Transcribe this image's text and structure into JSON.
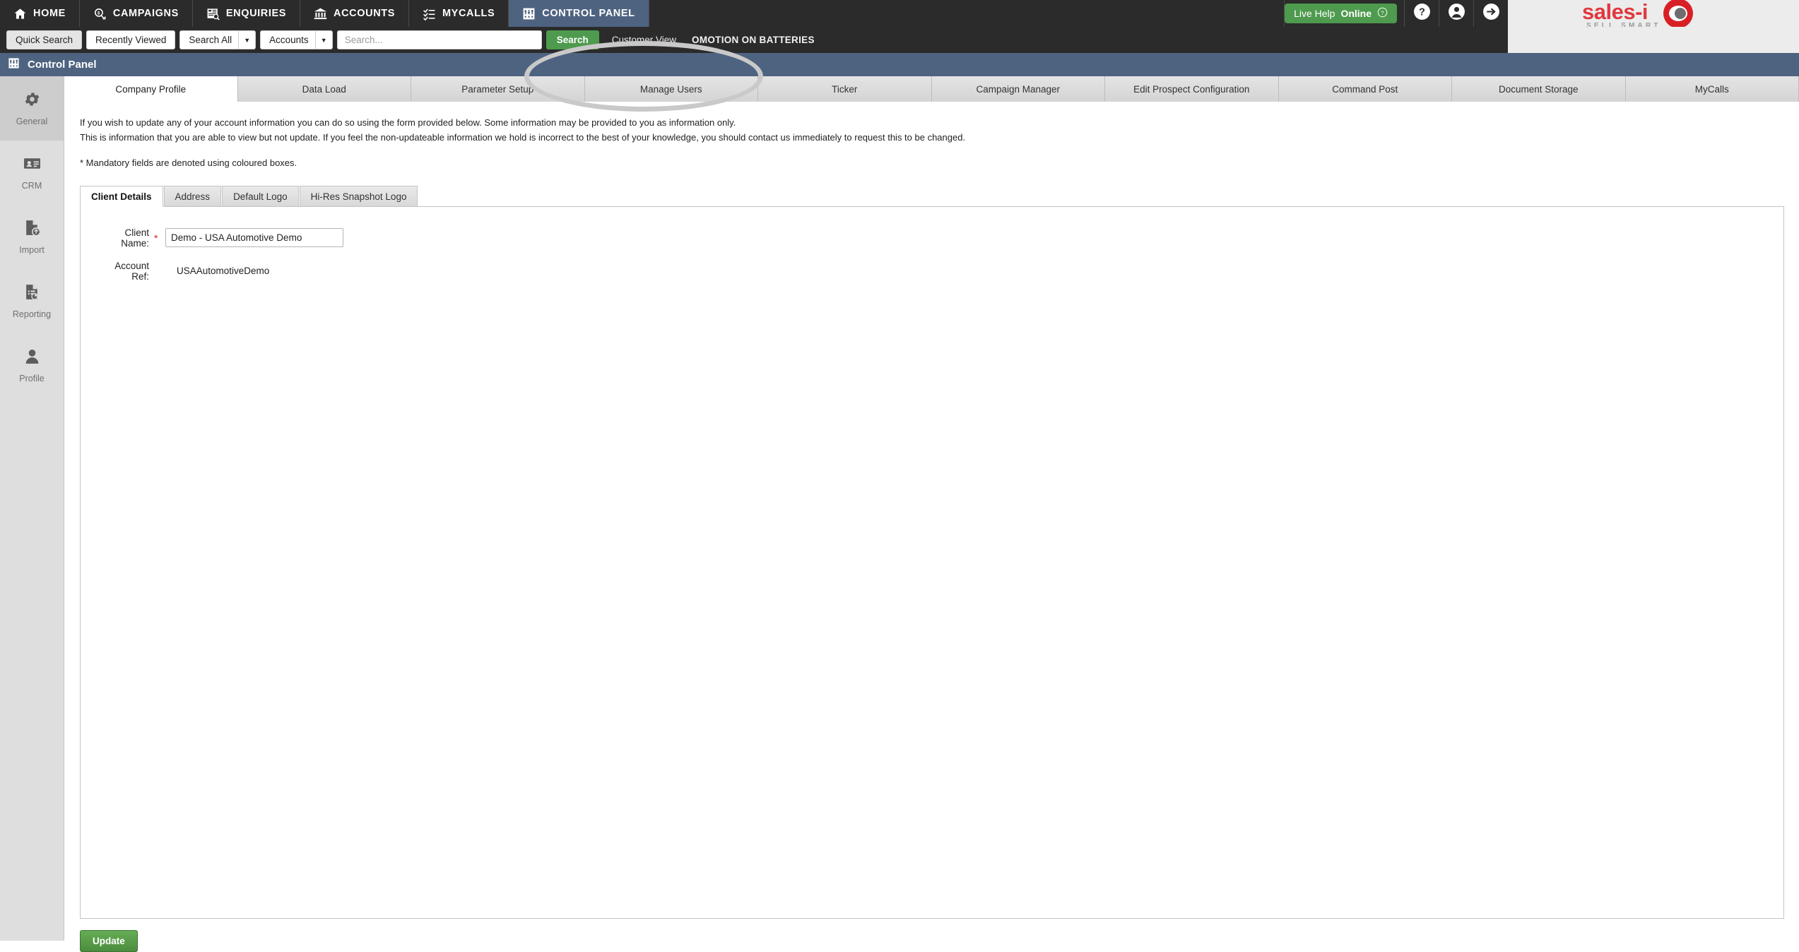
{
  "topnav": {
    "items": [
      {
        "label": "HOME",
        "icon": "home-icon",
        "active": false
      },
      {
        "label": "CAMPAIGNS",
        "icon": "campaigns-icon",
        "active": false
      },
      {
        "label": "ENQUIRIES",
        "icon": "enquiries-icon",
        "active": false
      },
      {
        "label": "ACCOUNTS",
        "icon": "accounts-icon",
        "active": false
      },
      {
        "label": "MYCALLS",
        "icon": "mycalls-icon",
        "active": false
      },
      {
        "label": "CONTROL PANEL",
        "icon": "control-panel-icon",
        "active": true
      }
    ],
    "live_help_light": "Live Help",
    "live_help_bold": "Online",
    "help_icon": "question-mark-icon",
    "account_icon": "user-avatar-icon",
    "logout_icon": "arrow-right-logout-icon"
  },
  "brand": {
    "name": "sales-i",
    "tagline": "SELL SMART",
    "logo_red": "#d81f26",
    "text_red": "#e0393f"
  },
  "searchbar": {
    "quick_search": "Quick Search",
    "recently_viewed": "Recently Viewed",
    "scope_select": "Search All",
    "type_select": "Accounts",
    "search_placeholder": "Search...",
    "search_value": "",
    "search_button": "Search",
    "customer_view": "Customer View",
    "ticker_text": "OMOTION ON BATTERIES"
  },
  "page_header": {
    "title": "Control Panel",
    "icon": "control-panel-icon",
    "bg": "#4e6380"
  },
  "sidebar": {
    "items": [
      {
        "label": "General",
        "icon": "gear-icon",
        "active": true
      },
      {
        "label": "CRM",
        "icon": "contact-card-icon",
        "active": false
      },
      {
        "label": "Import",
        "icon": "document-upload-icon",
        "active": false
      },
      {
        "label": "Reporting",
        "icon": "document-chart-icon",
        "active": false
      },
      {
        "label": "Profile",
        "icon": "person-icon",
        "active": false
      }
    ]
  },
  "tabs": [
    {
      "label": "Company Profile",
      "active": true
    },
    {
      "label": "Data Load",
      "active": false
    },
    {
      "label": "Parameter Setup",
      "active": false
    },
    {
      "label": "Manage Users",
      "active": false
    },
    {
      "label": "Ticker",
      "active": false
    },
    {
      "label": "Campaign Manager",
      "active": false
    },
    {
      "label": "Edit Prospect Configuration",
      "active": false
    },
    {
      "label": "Command Post",
      "active": false
    },
    {
      "label": "Document Storage",
      "active": false
    },
    {
      "label": "MyCalls",
      "active": false
    }
  ],
  "content": {
    "paragraph_1": "If you wish to update any of your account information you can do so using the form provided below. Some information may be provided to you as information only.",
    "paragraph_2": "This is information that you are able to view but not update. If you feel the non-updateable information we hold is incorrect to the best of your knowledge, you should contact us immediately to request this to be changed.",
    "paragraph_3": "* Mandatory fields are denoted using coloured boxes.",
    "subtabs": [
      {
        "label": "Client Details",
        "active": true
      },
      {
        "label": "Address",
        "active": false
      },
      {
        "label": "Default Logo",
        "active": false
      },
      {
        "label": "Hi-Res Snapshot Logo",
        "active": false
      }
    ],
    "form": {
      "client_name_label": "Client Name:",
      "client_name_required_mark": "*",
      "client_name_value": "Demo - USA Automotive Demo",
      "client_name_placeholder": "",
      "account_ref_label": "Account Ref:",
      "account_ref_value": "USAAutomotiveDemo"
    },
    "update_button": "Update"
  },
  "annotation": {
    "type": "oval-highlight",
    "target_tab": "Manage Users",
    "color": "#c9c9c9"
  }
}
